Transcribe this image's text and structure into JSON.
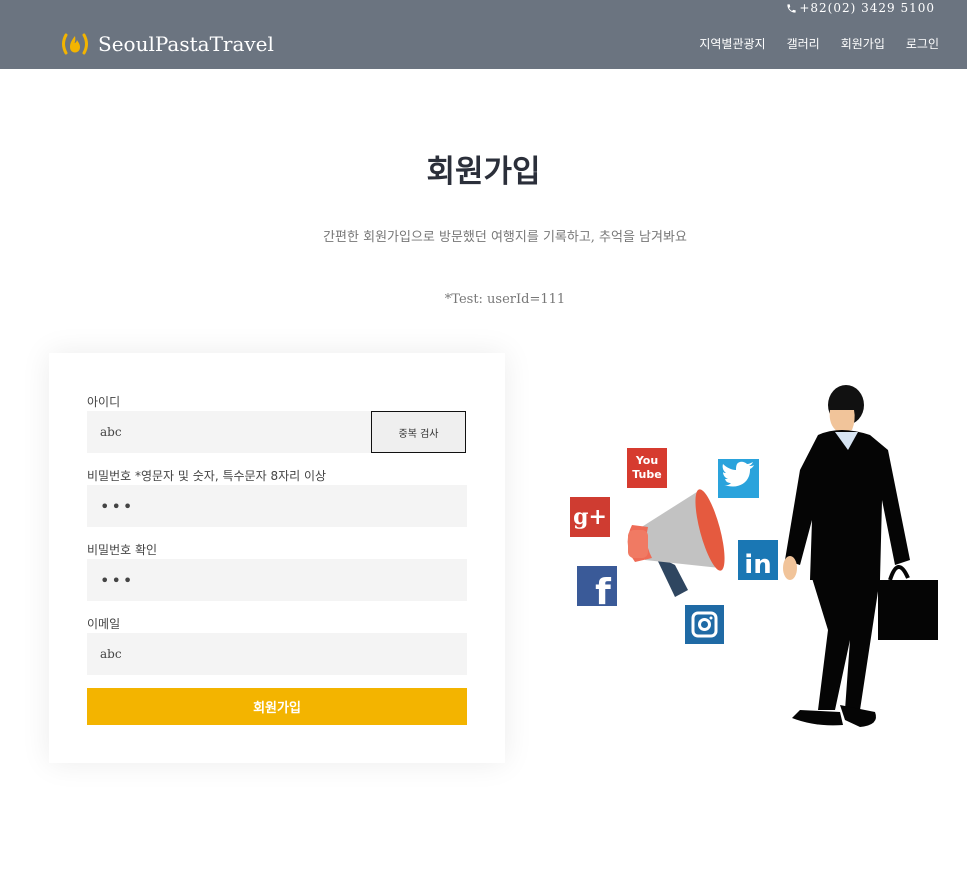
{
  "header": {
    "phone": "+82(02) 3429 5100",
    "brand": "SeoulPastaTravel",
    "nav": [
      "지역별관광지",
      "갤러리",
      "회원가입",
      "로그인"
    ],
    "bg_color": "#6b7480",
    "logo_color": "#f3b400"
  },
  "hero": {
    "title": "회원가입",
    "subtitle": "간편한 회원가입으로 방문했던 여행지를 기록하고, 추억을 남겨봐요",
    "test_note": "*Test: userId=111"
  },
  "form": {
    "id_label": "아이디",
    "id_value": "abc",
    "dup_check": "중복 검사",
    "pw_label": "비밀번호 *영문자 및 숫자, 특수문자 8자리 이상",
    "pw_value": "•••",
    "pw_confirm_label": "비밀번호 확인",
    "pw_confirm_value": "•••",
    "email_label": "이메일",
    "email_value": "abc",
    "submit": "회원가입",
    "submit_color": "#f3b400"
  },
  "illustration": {
    "icons": [
      "youtube-icon",
      "twitter-icon",
      "google-plus-icon",
      "linkedin-icon",
      "facebook-icon",
      "instagram-icon",
      "megaphone-icon"
    ],
    "youtube_text": [
      "You",
      "Tube"
    ],
    "google_text": "g+",
    "linkedin_text": "in",
    "facebook_text": "f"
  }
}
